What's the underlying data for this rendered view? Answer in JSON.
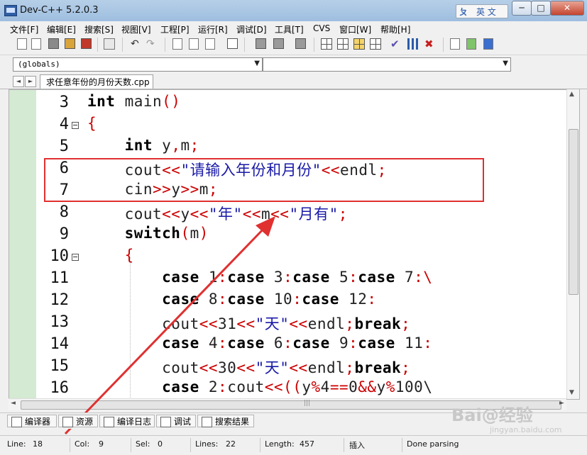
{
  "window": {
    "title": "Dev-C++ 5.2.0.3",
    "ime_label": "英 文",
    "ime_logo": "ㄆ",
    "buttons": {
      "minimize": "─",
      "maximize": "□",
      "close": "✕"
    }
  },
  "menu": [
    "文件[F]",
    "编辑[E]",
    "搜索[S]",
    "视图[V]",
    "工程[P]",
    "运行[R]",
    "调试[D]",
    "工具[T]",
    "CVS",
    "窗口[W]",
    "帮助[H]"
  ],
  "combos": {
    "scope": "(globals)",
    "symbol": "",
    "arrow": "▼"
  },
  "tabs": {
    "nav_left": "◄",
    "nav_right": "►",
    "file": "求任意年份的月份天数.cpp"
  },
  "scroll": {
    "up": "▲",
    "down": "▼",
    "left": "◄",
    "right": "►",
    "grip": "|||"
  },
  "editor": {
    "lines": [
      {
        "n": "3"
      },
      {
        "n": "4"
      },
      {
        "n": "5"
      },
      {
        "n": "6"
      },
      {
        "n": "7"
      },
      {
        "n": "8"
      },
      {
        "n": "9"
      },
      {
        "n": "10"
      },
      {
        "n": "11"
      },
      {
        "n": "12"
      },
      {
        "n": "13"
      },
      {
        "n": "14"
      },
      {
        "n": "15"
      },
      {
        "n": "16"
      }
    ],
    "tokens": {
      "l3": [
        "int",
        " main",
        "()"
      ],
      "l4": [
        "{"
      ],
      "l5": [
        "    ",
        "int",
        " y",
        ",",
        "m",
        ";"
      ],
      "l6": [
        "    cout",
        "<<",
        "\"请输入年份和月份\"",
        "<<",
        "endl",
        ";"
      ],
      "l7": [
        "    cin",
        ">>",
        "y",
        ">>",
        "m",
        ";"
      ],
      "l8": [
        "    cout",
        "<<",
        "y",
        "<<",
        "\"年\"",
        "<<",
        "m",
        "<<",
        "\"月有\"",
        ";"
      ],
      "l9": [
        "    ",
        "switch",
        "(",
        "m",
        ")"
      ],
      "l10": [
        "    ",
        "{"
      ],
      "l11": [
        "        ",
        "case",
        " 1",
        ":",
        "case",
        " 3",
        ":",
        "case",
        " 5",
        ":",
        "case",
        " 7",
        ":\\"
      ],
      "l12": [
        "        ",
        "case",
        " 8",
        ":",
        "case",
        " 10",
        ":",
        "case",
        " 12",
        ":"
      ],
      "l13": [
        "        cout",
        "<<",
        "31",
        "<<",
        "\"天\"",
        "<<",
        "endl",
        ";",
        "break",
        ";"
      ],
      "l14": [
        "        ",
        "case",
        " 4",
        ":",
        "case",
        " 6",
        ":",
        "case",
        " 9",
        ":",
        "case",
        " 11",
        ":"
      ],
      "l15": [
        "        cout",
        "<<",
        "30",
        "<<",
        "\"天\"",
        "<<",
        "endl",
        ";",
        "break",
        ";"
      ],
      "l16": [
        "        ",
        "case",
        " 2",
        ":",
        "cout",
        "<<((",
        "y",
        "%",
        "4",
        "==",
        "0",
        "&&",
        "y",
        "%",
        "100",
        "\\"
      ]
    }
  },
  "bottom_tabs": [
    "编译器",
    "资源",
    "编译日志",
    "调试",
    "搜索结果"
  ],
  "watermark": {
    "main": "Bai@经验",
    "sub": "jingyan.baidu.com"
  },
  "status": {
    "line_label": "Line:",
    "line": "18",
    "col_label": "Col:",
    "col": "9",
    "sel_label": "Sel:",
    "sel": "0",
    "lines_label": "Lines:",
    "lines": "22",
    "length_label": "Length:",
    "length": "457",
    "mode": "插入",
    "message": "Done parsing"
  },
  "colors": {
    "keyword": "#000000",
    "operator": "#cc0000",
    "string": "#1a1aa8",
    "highlight": "#e03030",
    "gutter": "#d4ead2"
  }
}
